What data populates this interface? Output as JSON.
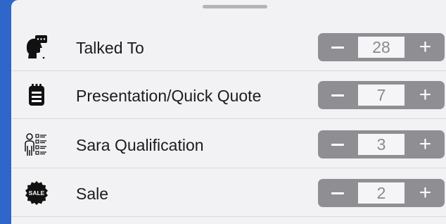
{
  "colors": {
    "backdrop": "#2f66c9",
    "sheet": "#f2f2f4",
    "stepper": "#8e8e93",
    "stepper_value_bg": "#f5f5f7"
  },
  "rows": [
    {
      "label": "Talked To",
      "icon": "talking-head-icon",
      "value": "28"
    },
    {
      "label": "Presentation/Quick Quote",
      "icon": "clipboard-icon",
      "value": "7"
    },
    {
      "label": "Sara Qualification",
      "icon": "person-checklist-icon",
      "value": "3"
    },
    {
      "label": "Sale",
      "icon": "sale-badge-icon",
      "value": "2",
      "icon_text": "SALE"
    }
  ],
  "stepper": {
    "minus_icon": "minus-icon",
    "plus_label": "+"
  }
}
